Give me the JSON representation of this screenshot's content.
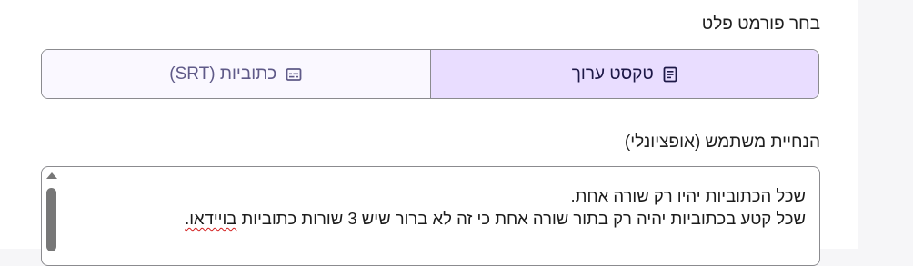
{
  "format_section": {
    "label": "בחר פורמט פלט",
    "options": [
      {
        "label": "טקסט ערוך",
        "icon": "document-icon",
        "selected": true
      },
      {
        "label": "כתוביות (SRT)",
        "icon": "subtitles-icon",
        "selected": false
      }
    ]
  },
  "instructions": {
    "label": "הנחיית משתמש (אופציונלי)",
    "line1": "שכל הכתוביות יהיו רק שורה אחת.",
    "line2_main": "שכל קטע בכתוביות יהיה רק בתור שורה אחת כי זה לא ברור שיש 3 שורות כתוביות ",
    "line2_misspelled": "בויידאו."
  },
  "colors": {
    "accent_selected_bg": "#e9ddff",
    "unselected_bg": "#faf8ff",
    "border": "#8b8b8f",
    "spellcheck_underline": "#d21b1b"
  }
}
